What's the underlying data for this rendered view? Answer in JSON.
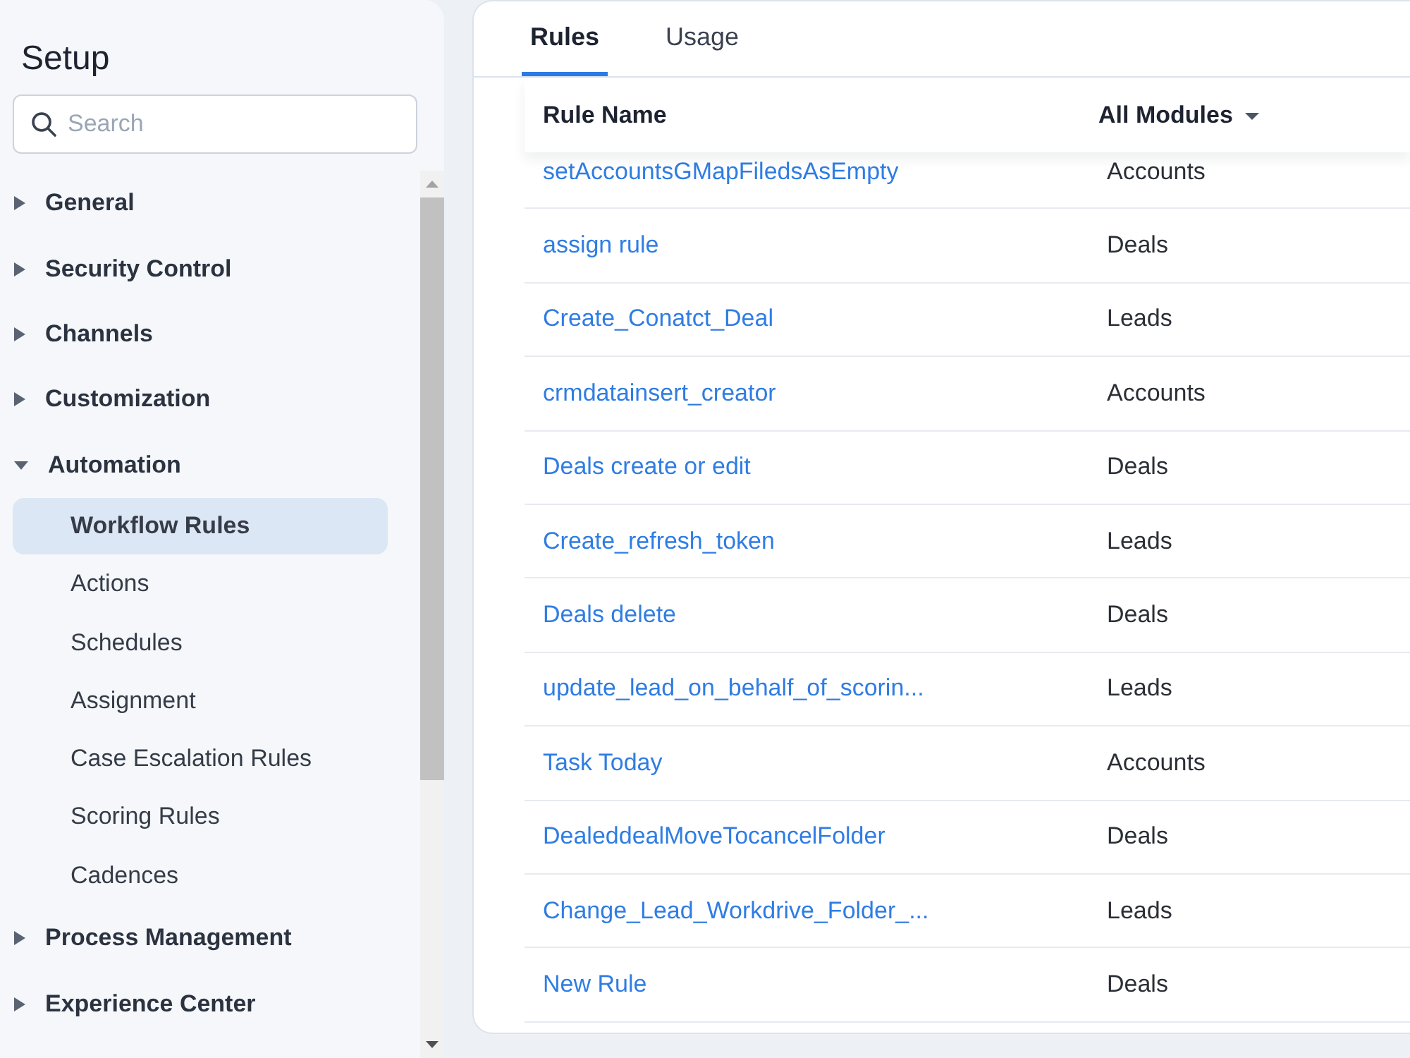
{
  "sidebar": {
    "title": "Setup",
    "search": {
      "placeholder": "Search"
    },
    "items": [
      {
        "label": "General",
        "expanded": false
      },
      {
        "label": "Security Control",
        "expanded": false
      },
      {
        "label": "Channels",
        "expanded": false
      },
      {
        "label": "Customization",
        "expanded": false
      },
      {
        "label": "Automation",
        "expanded": true,
        "children": [
          {
            "label": "Workflow Rules",
            "selected": true
          },
          {
            "label": "Actions",
            "selected": false
          },
          {
            "label": "Schedules",
            "selected": false
          },
          {
            "label": "Assignment",
            "selected": false
          },
          {
            "label": "Case Escalation Rules",
            "selected": false
          },
          {
            "label": "Scoring Rules",
            "selected": false
          },
          {
            "label": "Cadences",
            "selected": false
          }
        ]
      },
      {
        "label": "Process Management",
        "expanded": false
      },
      {
        "label": "Experience Center",
        "expanded": false
      }
    ]
  },
  "tabs": [
    {
      "label": "Rules",
      "selected": true
    },
    {
      "label": "Usage",
      "selected": false
    }
  ],
  "table": {
    "columns": [
      {
        "label": "Rule Name",
        "kind": "plain"
      },
      {
        "label": "All Modules",
        "kind": "dropdown"
      }
    ],
    "rows": [
      {
        "rule_name": "setAccountsGMapFiledsAsEmpty",
        "module": "Accounts"
      },
      {
        "rule_name": "assign rule",
        "module": "Deals"
      },
      {
        "rule_name": "Create_Conatct_Deal",
        "module": "Leads"
      },
      {
        "rule_name": "crmdatainsert_creator",
        "module": "Accounts"
      },
      {
        "rule_name": "Deals create or edit",
        "module": "Deals"
      },
      {
        "rule_name": "Create_refresh_token",
        "module": "Leads"
      },
      {
        "rule_name": "Deals delete",
        "module": "Deals"
      },
      {
        "rule_name": "update_lead_on_behalf_of_scorin...",
        "module": "Leads"
      },
      {
        "rule_name": "Task Today",
        "module": "Accounts"
      },
      {
        "rule_name": "DealeddealMoveTocancelFolder",
        "module": "Deals"
      },
      {
        "rule_name": "Change_Lead_Workdrive_Folder_...",
        "module": "Leads"
      },
      {
        "rule_name": "New Rule",
        "module": "Deals"
      }
    ]
  }
}
